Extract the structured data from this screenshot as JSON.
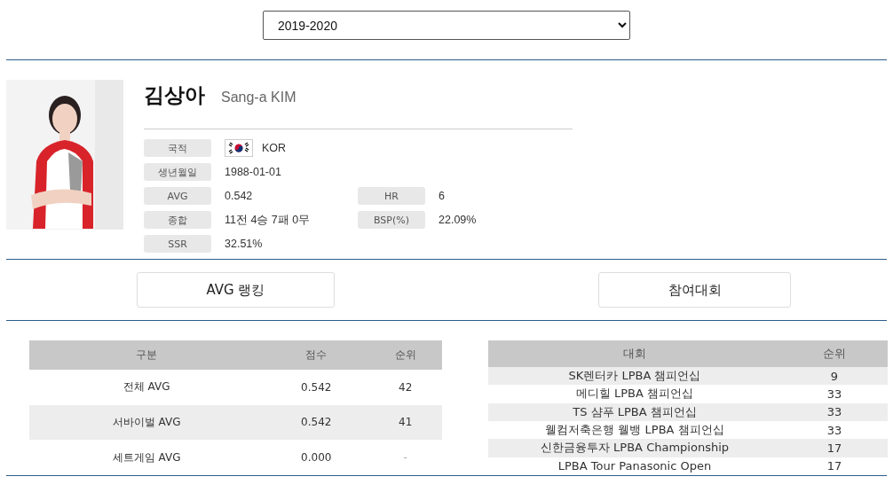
{
  "season_select": {
    "value": "2019-2020"
  },
  "player": {
    "name_ko": "김상아",
    "name_en": "Sang-a KIM",
    "info": [
      {
        "label": "국적",
        "value": "KOR",
        "kind": "flag"
      },
      {
        "label": "생년월일",
        "value": "1988-01-01",
        "kind": "text"
      },
      {
        "label": "AVG",
        "value": "0.542",
        "kind": "text",
        "side": {
          "label": "HR",
          "value": "6"
        }
      },
      {
        "label": "종합",
        "value": "11전 4승 7패 0무",
        "kind": "text",
        "side": {
          "label": "BSP(%)",
          "value": "22.09%"
        }
      },
      {
        "label": "SSR",
        "value": "32.51%",
        "kind": "text"
      }
    ]
  },
  "buttons": [
    "AVG 랭킹",
    "참여대회"
  ],
  "avg_table": {
    "columns": [
      "구분",
      "점수",
      "순위"
    ],
    "rows": [
      [
        "전체 AVG",
        "0.542",
        "42"
      ],
      [
        "서바이벌 AVG",
        "0.542",
        "41"
      ],
      [
        "세트게임 AVG",
        "0.000",
        "-"
      ]
    ]
  },
  "events_table": {
    "columns": [
      "대회",
      "순위"
    ],
    "rows": [
      [
        "SK렌터카 LPBA 챔피언십",
        "9"
      ],
      [
        "메디힐 LPBA 챔피언십",
        "33"
      ],
      [
        "TS 샴푸 LPBA 챔피언십",
        "33"
      ],
      [
        "웰컴저축은행 웰뱅 LPBA 챔피언십",
        "33"
      ],
      [
        "신한금융투자 LPBA Championship",
        "17"
      ],
      [
        "LPBA Tour Panasonic Open",
        "17"
      ]
    ]
  }
}
